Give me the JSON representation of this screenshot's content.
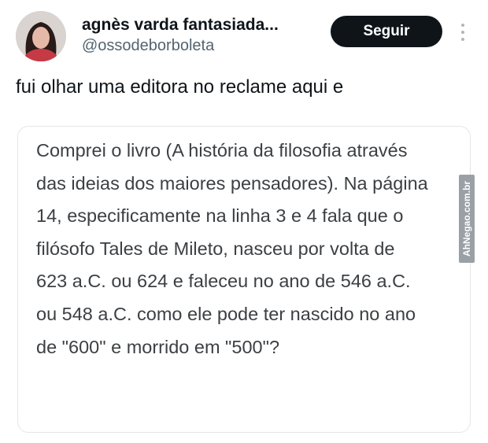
{
  "profile": {
    "display_name": "agnès varda fantasiada...",
    "handle": "@ossodeborboleta",
    "avatar_icon": "profile-photo"
  },
  "actions": {
    "follow_label": "Seguir",
    "more_icon": "vertical-ellipsis-icon"
  },
  "tweet": {
    "text": "fui olhar uma editora no reclame aqui e"
  },
  "quote": {
    "text": "Comprei o livro (A história da filosofia através das ideias dos maiores pensadores). Na página 14, especificamente na linha 3 e 4 fala que o filósofo Tales de Mileto, nasceu por volta de 623 a.C. ou 624 e faleceu no ano de 546 a.C. ou 548 a.C. como ele pode ter nascido no ano de \"600\" e morrido em \"500\"?"
  },
  "watermark": {
    "text": "AhNegao.com.br"
  },
  "colors": {
    "follow_button_bg": "#0f1419",
    "handle_gray": "#536471",
    "quote_text": "#3c4043",
    "card_border": "#e6e6e6"
  }
}
